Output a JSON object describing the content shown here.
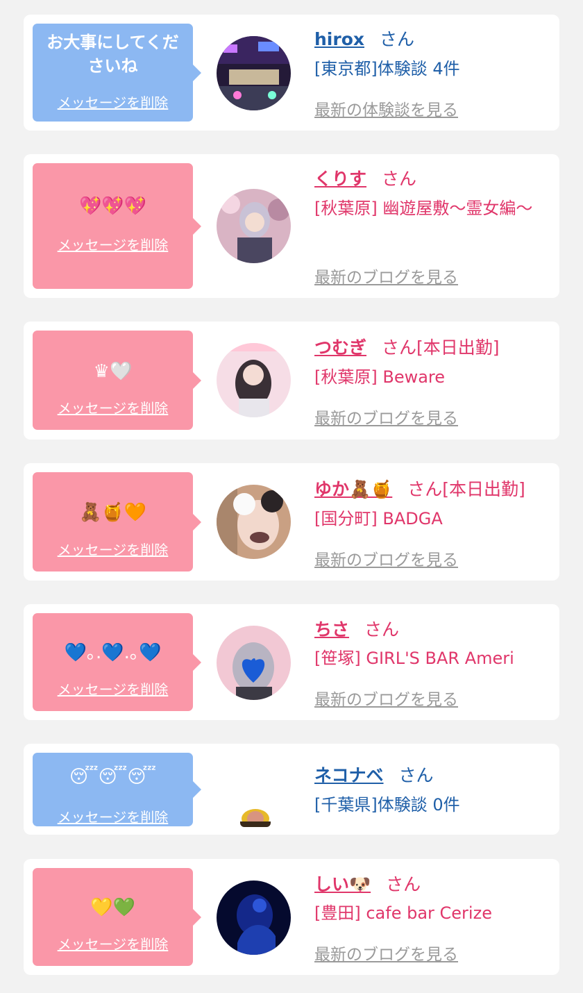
{
  "delete_label": "メッセージを削除",
  "san": "さん",
  "colors": {
    "bubble_blue": "#8cb8f2",
    "bubble_pink": "#fa97a8",
    "text_blue": "#1f5fa8",
    "text_pink": "#e0366a",
    "link_gray": "#9a9a9a",
    "background": "#f2f2f2"
  },
  "messages": [
    {
      "message": "お大事にしてくださいね",
      "name": "hirox",
      "status": "",
      "place": "[東京都]体験談 4件",
      "link": "最新の体験談を見る"
    },
    {
      "message": "💖💖💖",
      "name": "くりす",
      "status": "",
      "place": "[秋葉原] 幽遊屋敷〜霊女編〜",
      "link": "最新のブログを見る"
    },
    {
      "message": "♛🤍",
      "name": "つむぎ",
      "status": "[本日出勤]",
      "place": "[秋葉原] Beware",
      "link": "最新のブログを見る"
    },
    {
      "message": "🧸🍯🧡",
      "name": "ゆか🧸🍯",
      "status": "[本日出勤]",
      "place": "[国分町] BADGA",
      "link": "最新のブログを見る"
    },
    {
      "message": "💙｡.💙.｡💙",
      "name": "ちさ",
      "status": "",
      "place": "[笹塚] GIRL'S BAR Ameri",
      "link": "最新のブログを見る"
    },
    {
      "message": "😴😴😴",
      "name": "ネコナベ",
      "status": "",
      "place": "[千葉県]体験談 0件",
      "link": ""
    },
    {
      "message": "💛💚",
      "name": "しい🐶",
      "status": "",
      "place": "[豊田] cafe bar Cerize",
      "link": "最新のブログを見る"
    }
  ]
}
